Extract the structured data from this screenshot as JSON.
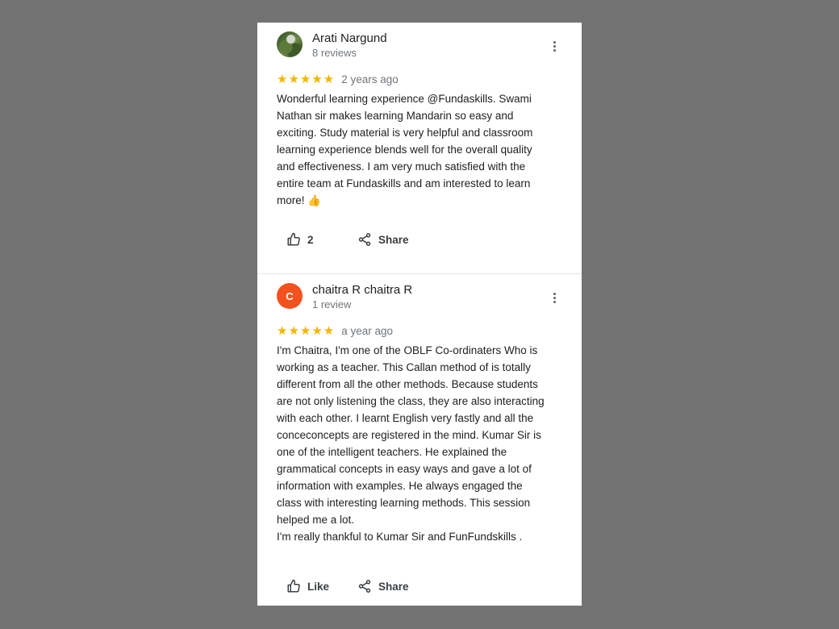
{
  "reviews": [
    {
      "author": "Arati Nargund",
      "review_count": "8 reviews",
      "avatar": {
        "type": "photo",
        "letter": ""
      },
      "stars": "★★★★★",
      "rating": 5,
      "date": "2 years ago",
      "text": "Wonderful learning experience @Fundaskills. Swami\nNathan sir makes learning Mandarin so easy and\nexciting. Study material is very helpful and classroom\nlearning experience blends well for the overall quality\nand effectiveness. I am very much satisfied with the\nentire team at Fundaskills and am interested to learn\nmore! 👍",
      "like_label": "2",
      "share_label": "Share"
    },
    {
      "author": "chaitra R chaitra R",
      "review_count": "1 review",
      "avatar": {
        "type": "letter",
        "letter": "C",
        "color": "#f4511e"
      },
      "stars": "★★★★★",
      "rating": 5,
      "date": "a year ago",
      "text": "I'm Chaitra, I'm one of the OBLF Co-ordinaters  Who is\nworking as a teacher. This Callan method of is totally\ndifferent  from all the other methods. Because students\nare not only listening the class, they are also interacting\nwith each other. I learnt English very fastly and all the\nconceconcepts are registered in the mind. Kumar Sir is\none of the intelligent teachers. He explained the\ngrammatical concepts in easy ways and gave a lot of\ninformation  with examples. He always engaged the\nclass with interesting learning methods. This session\nhelped me a lot.\nI'm really thankful to Kumar Sir and FunFundskills .",
      "like_label": "Like",
      "share_label": "Share"
    }
  ],
  "colors": {
    "background": "#737373",
    "star": "#f4b400",
    "secondary_text": "#70757a"
  }
}
